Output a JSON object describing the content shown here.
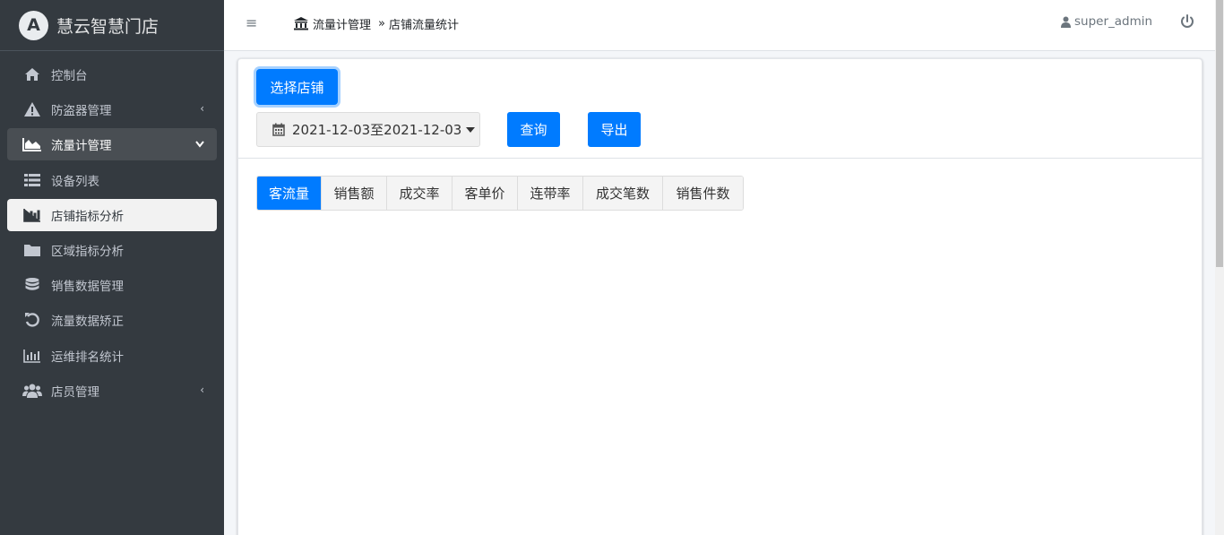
{
  "brand": {
    "logo_letter": "A",
    "title": "慧云智慧门店"
  },
  "sidebar": {
    "items": [
      {
        "label": "控制台",
        "icon": "home-icon"
      },
      {
        "label": "防盗器管理",
        "icon": "warning-icon",
        "arrow": "‹"
      },
      {
        "label": "流量计管理",
        "icon": "area-chart-icon",
        "arrow": "⌄"
      },
      {
        "label": "设备列表",
        "icon": "list-icon"
      },
      {
        "label": "店铺指标分析",
        "icon": "bar-chart-icon"
      },
      {
        "label": "区域指标分析",
        "icon": "folder-icon"
      },
      {
        "label": "销售数据管理",
        "icon": "database-icon"
      },
      {
        "label": "流量数据矫正",
        "icon": "undo-icon"
      },
      {
        "label": "运维排名统计",
        "icon": "bar-chart-icon"
      },
      {
        "label": "店员管理",
        "icon": "users-icon",
        "arrow": "‹"
      }
    ]
  },
  "header": {
    "menu_icon": "≡",
    "breadcrumb": {
      "parent": "流量计管理",
      "separator": "»",
      "current": "店铺流量统计"
    },
    "username": "super_admin"
  },
  "toolbar": {
    "select_store_label": "选择店铺",
    "date_range": "2021-12-03至2021-12-03",
    "query_label": "查询",
    "export_label": "导出"
  },
  "tabs": [
    {
      "label": "客流量",
      "active": true
    },
    {
      "label": "销售额"
    },
    {
      "label": "成交率"
    },
    {
      "label": "客单价"
    },
    {
      "label": "连带率"
    },
    {
      "label": "成交笔数"
    },
    {
      "label": "销售件数"
    }
  ],
  "colors": {
    "primary": "#007bff",
    "sidebar": "#343a40"
  }
}
